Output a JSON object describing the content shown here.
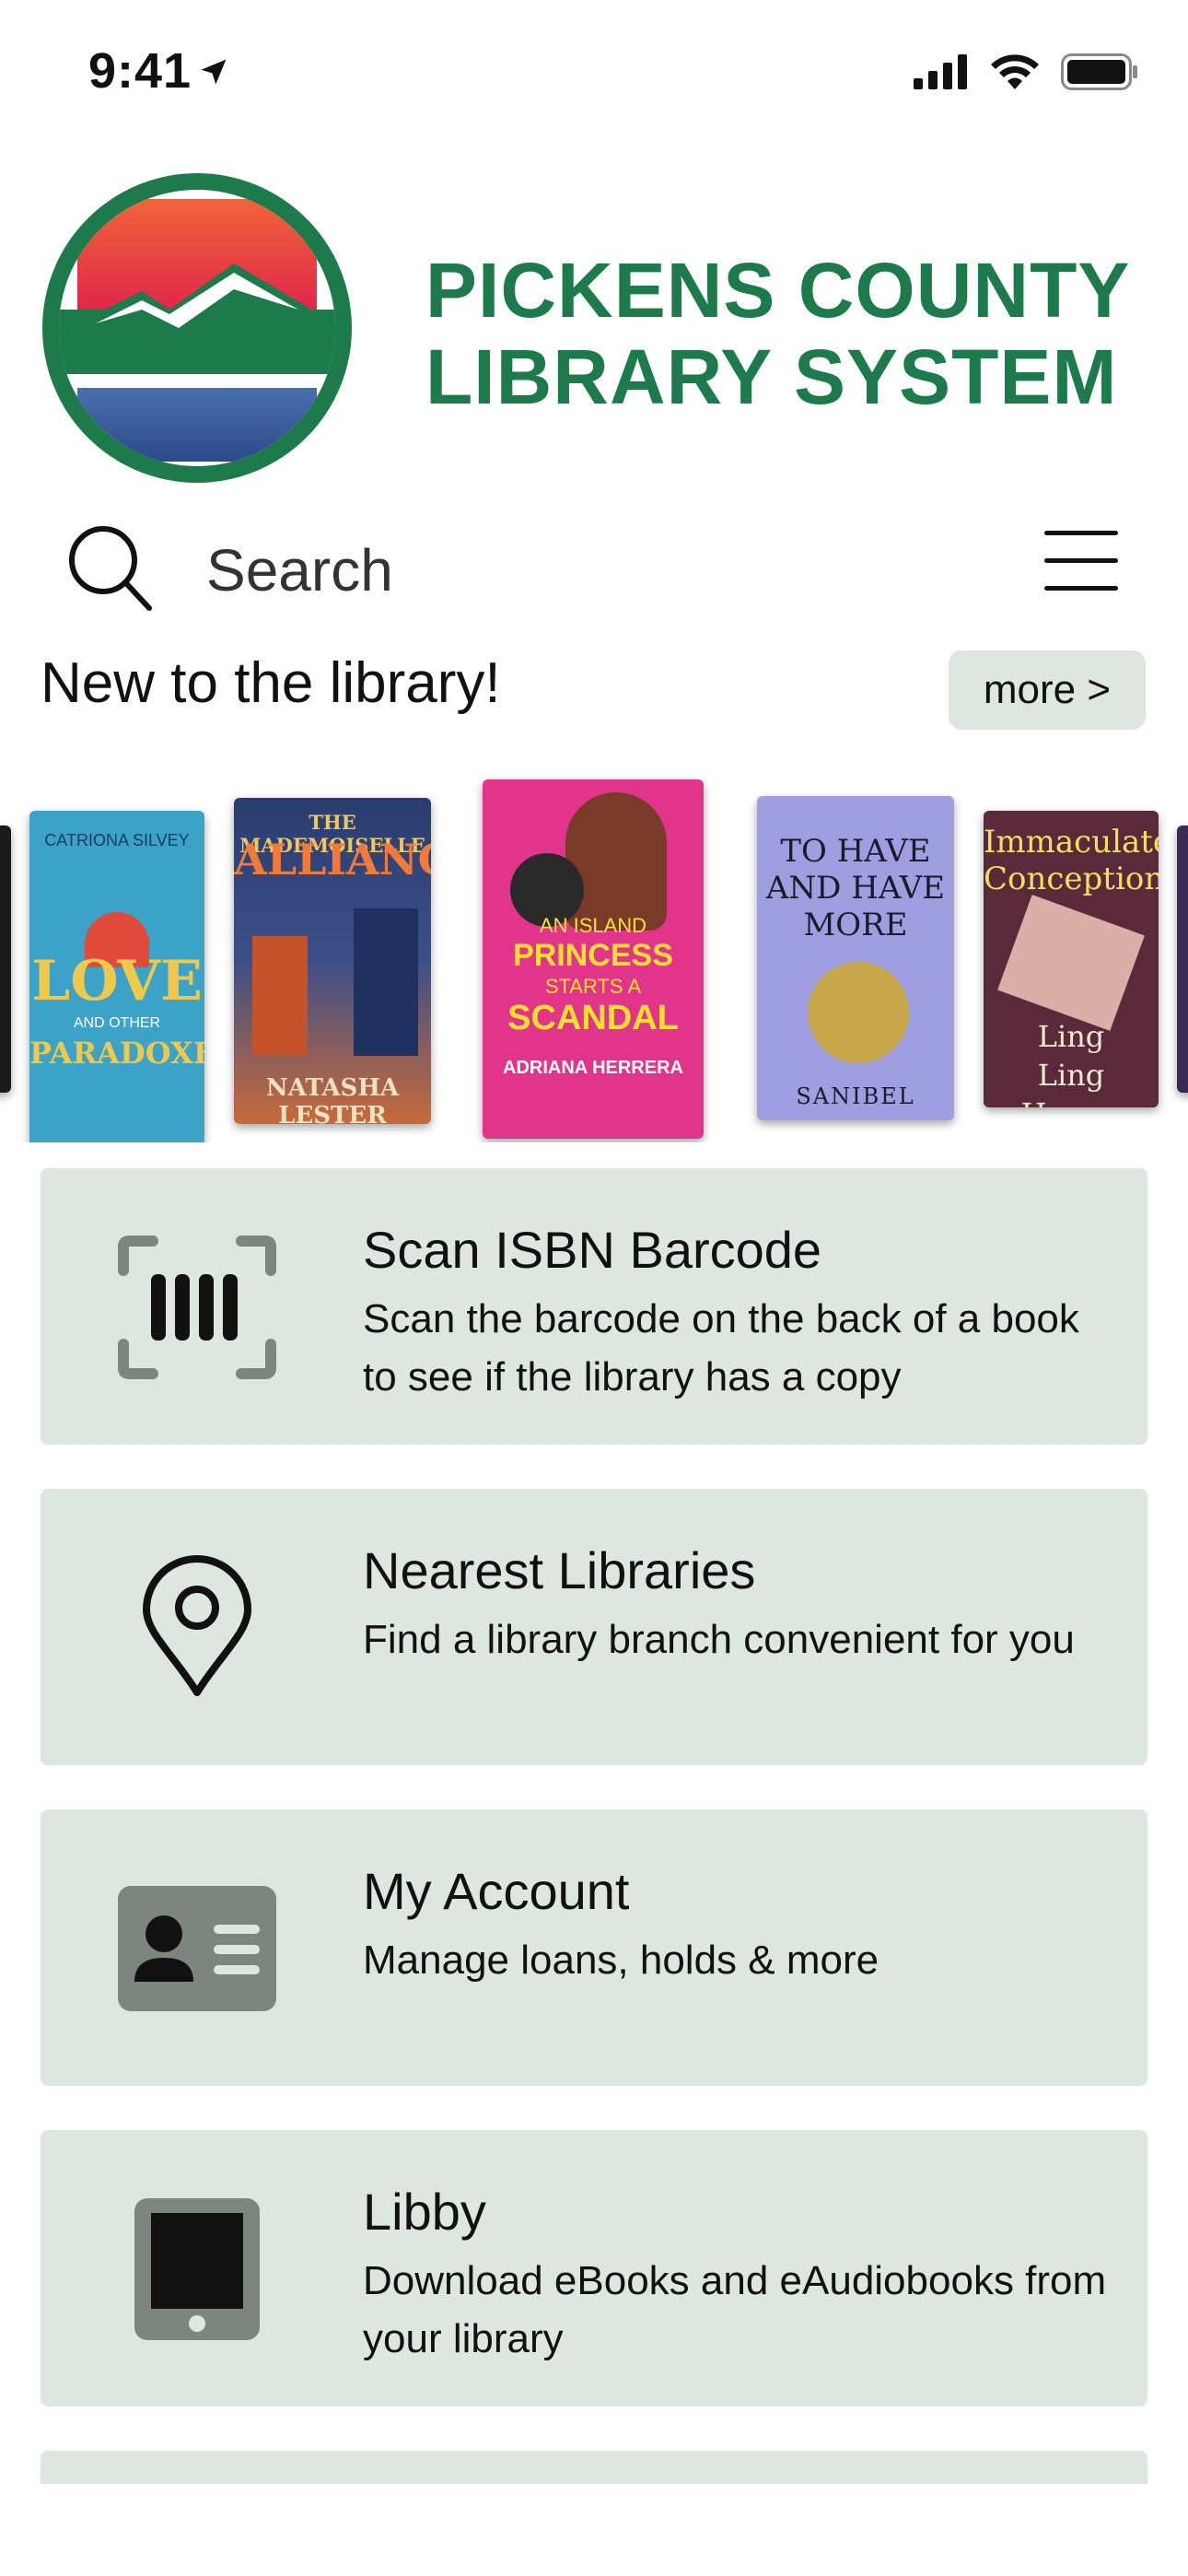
{
  "status_bar": {
    "time": "9:41"
  },
  "brand": {
    "line1": "PICKENS COUNTY",
    "line2": "LIBRARY SYSTEM",
    "color": "#1d7a4a"
  },
  "search": {
    "label": "Search"
  },
  "new_section": {
    "title": "New to the library!",
    "more_label": "more >"
  },
  "books": [
    {
      "author": "CATRIONA SILVEY",
      "title_main": "LOVE",
      "title_mid": "AND OTHER",
      "title_end": "PARADOXES"
    },
    {
      "title_top": "THE MADEMOISELLE",
      "title_main": "ALLIANCE",
      "author": "NATASHA LESTER"
    },
    {
      "title_top": "AN ISLAND",
      "title_main": "PRINCESS",
      "title_mid": "STARTS A",
      "title_end": "SCANDAL",
      "author": "ADRIANA HERRERA"
    },
    {
      "title_top": "TO HAVE",
      "title_mid": "AND HAVE",
      "title_end": "MORE",
      "author": "SANIBEL"
    },
    {
      "title_top": "Immaculate",
      "title_mid": "Conception",
      "author": "Ling Ling Huang"
    }
  ],
  "cards": [
    {
      "title": "Scan ISBN Barcode",
      "desc": "Scan the barcode on the back of a book to see if the library has a copy",
      "icon": "barcode-scan-icon"
    },
    {
      "title": "Nearest Libraries",
      "desc": "Find a library branch convenient for you",
      "icon": "map-pin-icon"
    },
    {
      "title": "My Account",
      "desc": "Manage loans, holds & more",
      "icon": "id-card-icon"
    },
    {
      "title": "Libby",
      "desc": "Download eBooks and eAudiobooks from your library",
      "icon": "tablet-icon"
    }
  ],
  "colors": {
    "card_bg": "#dde7e0",
    "icon_gray": "#7d857f"
  }
}
